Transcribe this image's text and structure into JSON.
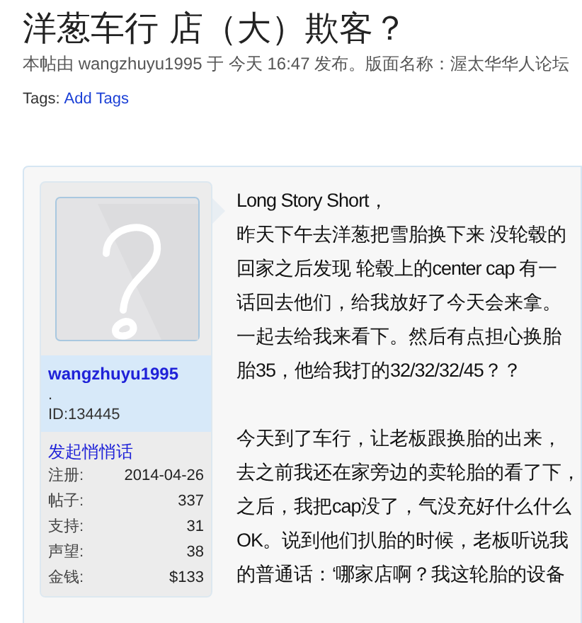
{
  "title": "洋葱车行 店（大）欺客？",
  "byline": "本帖由 wangzhuyu1995 于 今天 16:47 发布。版面名称：渥太华华人论坛",
  "tags": {
    "label": "Tags:",
    "link": "Add Tags"
  },
  "author": {
    "name": "wangzhuyu1995",
    "dot": ".",
    "id": "ID:134445",
    "message_link": "发起悄悄话",
    "stats": [
      {
        "label": "注册:",
        "value": "2014-04-26"
      },
      {
        "label": "帖子:",
        "value": "337"
      },
      {
        "label": "支持:",
        "value": "31"
      },
      {
        "label": "声望:",
        "value": "38"
      },
      {
        "label": "金钱:",
        "value": "$133"
      }
    ]
  },
  "post_paragraphs": [
    [
      "Long Story Short，",
      "昨天下午去洋葱把雪胎换下来 没轮毂的",
      "回家之后发现 轮毂上的center cap 有一",
      "话回去他们，给我放好了今天会来拿。",
      "一起去给我来看下。然后有点担心换胎",
      "胎35，他给我打的32/32/32/45？？"
    ],
    [
      "今天到了车行，让老板跟换胎的出来，",
      "去之前我还在家旁边的卖轮胎的看了下，",
      "之后，我把cap没了，气没充好什么什么",
      "OK。说到他们扒胎的时候，老板听说我",
      "的普通话：‘哪家店啊？我这轮胎的设备"
    ]
  ]
}
